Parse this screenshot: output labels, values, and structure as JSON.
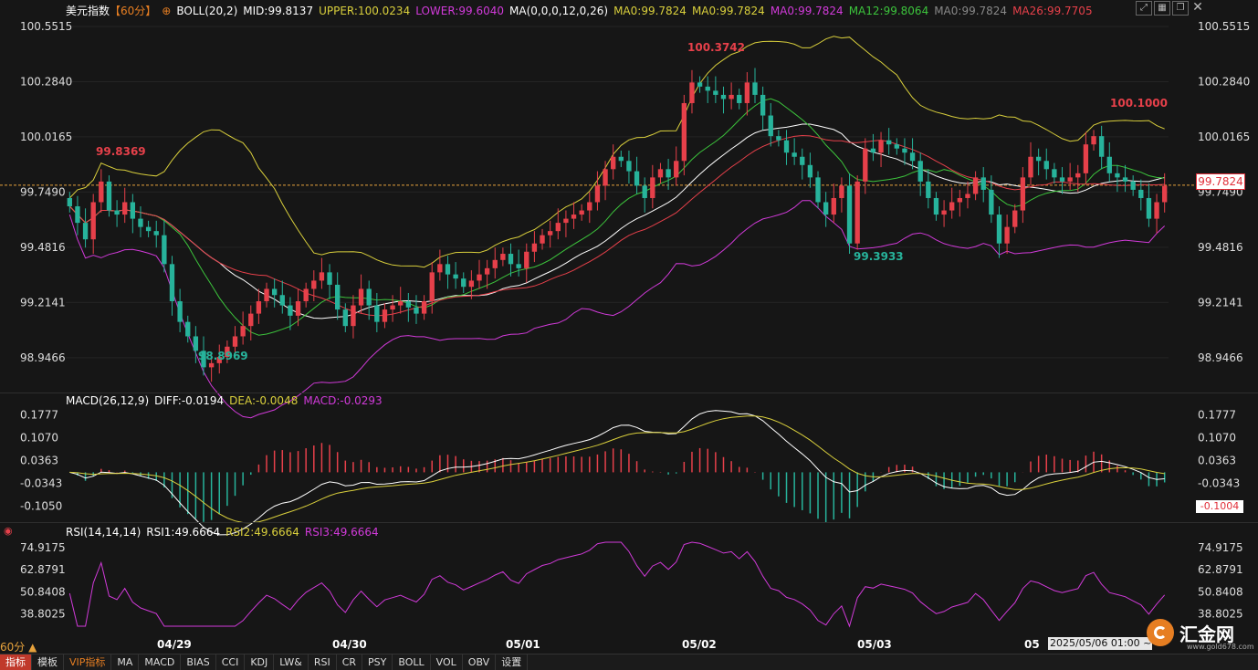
{
  "header": {
    "instrument": "美元指数",
    "period": "【60分】",
    "boll": "BOLL(20,2)",
    "mid": "MID:99.8137",
    "upper": "UPPER:100.0234",
    "lower": "LOWER:99.6040",
    "ma_params": "MA(0,0,0,12,0,26)",
    "ma0_a": "MA0:99.7824",
    "ma0_b": "MA0:99.7824",
    "ma0_c": "MA0:99.7824",
    "ma12": "MA12:99.8064",
    "ma0_d": "MA0:99.7824",
    "ma26": "MA26:99.7705"
  },
  "macd_header": {
    "params": "MACD(26,12,9)",
    "diff": "DIFF:-0.0194",
    "dea": "DEA:-0.0048",
    "macd": "MACD:-0.0293"
  },
  "rsi_header": {
    "params": "RSI(14,14,14)",
    "rsi1": "RSI1:49.6664",
    "rsi2": "RSI2:49.6664",
    "rsi3": "RSI3:49.6664"
  },
  "price_axis": [
    "100.5515",
    "100.2840",
    "100.0165",
    "99.7490",
    "99.4816",
    "99.2141",
    "98.9466"
  ],
  "macd_axis": [
    "0.1777",
    "0.1070",
    "0.0363",
    "-0.0343",
    "-0.1050"
  ],
  "rsi_axis": [
    "74.9175",
    "62.8791",
    "50.8408",
    "38.8025"
  ],
  "last_price": "99.7824",
  "macd_last": "-0.1004",
  "annotations": {
    "high1": "99.8369",
    "low1": "98.8969",
    "high2": "100.3742",
    "low2": "99.3933",
    "high3": "100.1000"
  },
  "dates": [
    "04/29",
    "04/30",
    "05/01",
    "05/02",
    "05/03",
    "05"
  ],
  "cursor_time": "2025/05/06 01:00 ~",
  "period_label": "60分",
  "logo": {
    "name": "汇金网",
    "url": "www.gold678.com"
  },
  "toolbar": [
    "指标",
    "模板",
    "VIP指标",
    "MA",
    "MACD",
    "BIAS",
    "CCI",
    "KDJ",
    "LW&",
    "RSI",
    "CR",
    "PSY",
    "BOLL",
    "VOL",
    "OBV",
    "设置"
  ],
  "colors": {
    "up": "#e6404a",
    "down": "#27b39b",
    "upper": "#d9cf3c",
    "lower": "#d13ad9",
    "mid": "#ffffff",
    "ma12": "#3cc43c",
    "ma26": "#e6404a",
    "diff": "#ffffff",
    "dea": "#d9cf3c",
    "rsi": "#d13ad9"
  },
  "chart_data": {
    "type": "candlestick",
    "title": "美元指数 60分",
    "ylim": [
      98.8,
      100.6
    ],
    "close": [
      99.68,
      99.6,
      99.52,
      99.7,
      99.8,
      99.66,
      99.64,
      99.7,
      99.62,
      99.58,
      99.56,
      99.54,
      99.4,
      99.22,
      99.12,
      99.05,
      98.98,
      98.9,
      98.92,
      98.95,
      99.0,
      99.05,
      99.1,
      99.16,
      99.22,
      99.28,
      99.25,
      99.2,
      99.15,
      99.22,
      99.28,
      99.32,
      99.36,
      99.3,
      99.18,
      99.1,
      99.2,
      99.28,
      99.2,
      99.12,
      99.18,
      99.2,
      99.22,
      99.19,
      99.16,
      99.22,
      99.36,
      99.4,
      99.35,
      99.33,
      99.29,
      99.32,
      99.35,
      99.38,
      99.42,
      99.45,
      99.4,
      99.38,
      99.46,
      99.5,
      99.54,
      99.56,
      99.6,
      99.62,
      99.64,
      99.66,
      99.7,
      99.78,
      99.86,
      99.92,
      99.9,
      99.85,
      99.78,
      99.72,
      99.82,
      99.86,
      99.82,
      99.9,
      100.18,
      100.28,
      100.26,
      100.24,
      100.22,
      100.2,
      100.22,
      100.18,
      100.28,
      100.22,
      100.12,
      100.02,
      100.0,
      99.94,
      99.92,
      99.88,
      99.82,
      99.7,
      99.64,
      99.72,
      99.78,
      99.5,
      99.8,
      99.96,
      99.94,
      100.0,
      99.98,
      99.96,
      99.94,
      99.9,
      99.8,
      99.72,
      99.64,
      99.66,
      99.7,
      99.72,
      99.74,
      99.82,
      99.76,
      99.64,
      99.5,
      99.58,
      99.66,
      99.82,
      99.92,
      99.9,
      99.86,
      99.82,
      99.8,
      99.82,
      99.84,
      99.98,
      100.02,
      99.92,
      99.84,
      99.82,
      99.8,
      99.76,
      99.72,
      99.62,
      99.7,
      99.78
    ],
    "boll_upper_range": [
      99.5,
      100.52
    ],
    "boll_lower_range": [
      98.85,
      99.81
    ],
    "macd_range": [
      -0.12,
      0.19
    ],
    "rsi_range": [
      30,
      80
    ]
  }
}
